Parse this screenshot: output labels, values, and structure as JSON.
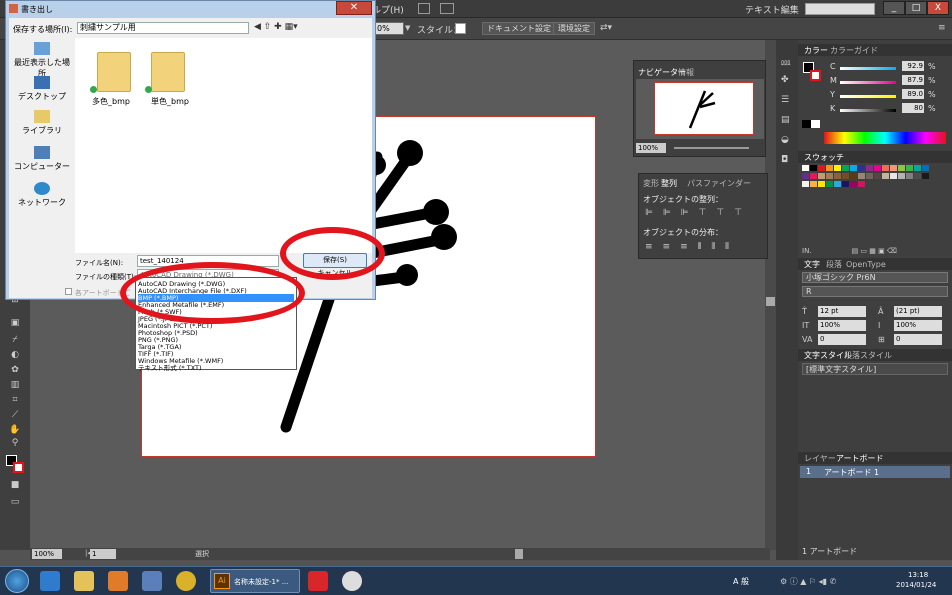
{
  "menubar": {
    "help_menu": "ルプ(H)",
    "right_label": "テキスト編集",
    "window_buttons": [
      "_",
      "□",
      "X"
    ]
  },
  "controlbar": {
    "zoom": "0%",
    "style_label": "スタイル：",
    "doc_settings": "ドキュメント設定",
    "env_settings": "環境設定"
  },
  "status": {
    "zoom": "100%",
    "page": "1",
    "selection": "選択"
  },
  "dialog": {
    "title": "書き出し",
    "save_in_label": "保存する場所(I):",
    "save_in_value": "刺繍サンプル用",
    "nav_items": [
      {
        "label": "最近表示した場所",
        "icon": "recent-places-icon"
      },
      {
        "label": "デスクトップ",
        "icon": "desktop-icon"
      },
      {
        "label": "ライブラリ",
        "icon": "library-icon"
      },
      {
        "label": "コンピューター",
        "icon": "computer-icon"
      },
      {
        "label": "ネットワーク",
        "icon": "network-icon"
      }
    ],
    "files": [
      {
        "name": "多色_bmp"
      },
      {
        "name": "単色_bmp"
      }
    ],
    "filename_label": "ファイル名(N):",
    "filename_value": "test_140124",
    "filetype_label": "ファイルの種類(T):",
    "filetype_value": "AutoCAD Drawing (*.DWG)",
    "artboard_checkbox": "各アートボードご",
    "save_button": "保存(S)",
    "cancel_button": "キャンセル",
    "filetype_options": [
      "AutoCAD Drawing (*.DWG)",
      "AutoCAD Interchange File (*.DXF)",
      "BMP (*.BMP)",
      "Enhanced Metafile (*.EMF)",
      "Flash (*.SWF)",
      "JPEG (*.JPG)",
      "Macintosh PICT (*.PCT)",
      "Photoshop (*.PSD)",
      "PNG (*.PNG)",
      "Targa (*.TGA)",
      "TIFF (*.TIF)",
      "Windows Metafile (*.WMF)",
      "テキスト形式 (*.TXT)"
    ],
    "selected_option": 2
  },
  "navigator": {
    "tab": "ナビゲーター",
    "tab2": "情報",
    "zoom": "100%"
  },
  "align": {
    "tab1": "変形",
    "tab2": "整列",
    "tab3": "パスファインダー",
    "section1": "オブジェクトの整列：",
    "section2": "オブジェクトの分布："
  },
  "color": {
    "tab1": "カラー",
    "tab2": "カラーガイド",
    "channels": [
      {
        "name": "C",
        "value": "92.9"
      },
      {
        "name": "M",
        "value": "87.9"
      },
      {
        "name": "Y",
        "value": "89.0"
      },
      {
        "name": "K",
        "value": "80"
      }
    ],
    "unit": "%"
  },
  "swatches": {
    "tab": "スウォッチ"
  },
  "character": {
    "tab1": "文字",
    "tab2": "段落",
    "tab3": "OpenType",
    "font": "小塚ゴシック Pr6N",
    "weight": "R",
    "size": "12 pt",
    "leading": "(21 pt)",
    "hscale": "100%",
    "vscale": "100%",
    "tracking": "0",
    "kerning": "0"
  },
  "char_style": {
    "tab1": "文字スタイル",
    "tab2": "段落スタイル",
    "item": "[標準文字スタイル]"
  },
  "layers": {
    "tab1": "レイヤー",
    "tab2": "アートボード",
    "row_num": "1",
    "row_name": "アートボード 1",
    "footer": "1 アートボード"
  },
  "taskbar": {
    "active_app": "名称未設定-1* ...",
    "time": "13:18",
    "date": "2014/01/24",
    "ime": "A 般"
  },
  "colors": {
    "accent_red": "#e2141c",
    "selected_blue": "#3390ff",
    "dialog_frame": "#b9d0ea"
  }
}
